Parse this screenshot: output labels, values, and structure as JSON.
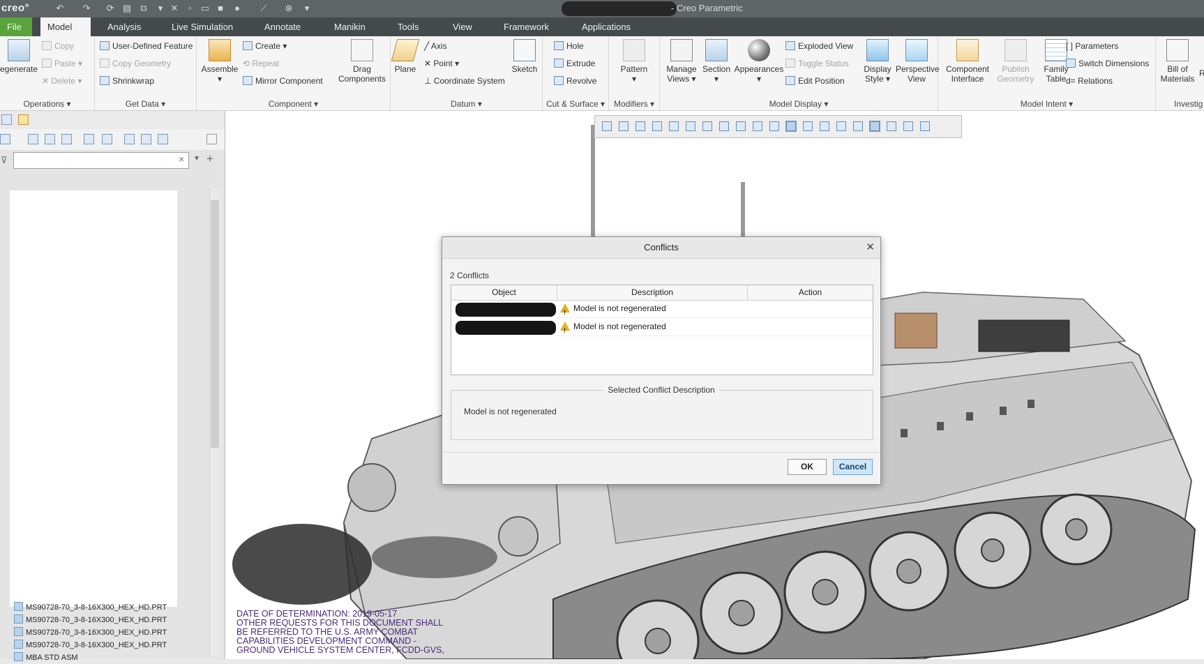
{
  "titlebar": {
    "logo": "creo°",
    "window_title": "- Creo Parametric"
  },
  "tabs": [
    "File",
    "Model",
    "Analysis",
    "Live Simulation",
    "Annotate",
    "Manikin",
    "Tools",
    "View",
    "Framework",
    "Applications"
  ],
  "ribbon": {
    "operations": {
      "regenerate": "egenerate",
      "copy": "Copy",
      "paste": "Paste",
      "delete": "Delete",
      "label": "Operations"
    },
    "get_data": {
      "udf": "User-Defined Feature",
      "copy_geometry": "Copy Geometry",
      "shrinkwrap": "Shrinkwrap",
      "label": "Get Data"
    },
    "component": {
      "assemble": "Assemble",
      "create": "Create",
      "repeat": "Repeat",
      "mirror": "Mirror Component",
      "drag_1": "Drag",
      "drag_2": "Components",
      "label": "Component"
    },
    "datum": {
      "plane": "Plane",
      "axis": "Axis",
      "point": "Point",
      "coord": "Coordinate System",
      "sketch": "Sketch",
      "label": "Datum"
    },
    "cut_surface": {
      "hole": "Hole",
      "extrude": "Extrude",
      "revolve": "Revolve",
      "label": "Cut & Surface"
    },
    "modifiers": {
      "pattern": "Pattern",
      "label": "Modifiers"
    },
    "model_display": {
      "manage_1": "Manage",
      "manage_2": "Views",
      "section": "Section",
      "appearances": "Appearances",
      "exploded": "Exploded View",
      "toggle": "Toggle Status",
      "edit_pos": "Edit Position",
      "display_1": "Display",
      "display_2": "Style",
      "persp_1": "Perspective",
      "persp_2": "View",
      "label": "Model Display"
    },
    "model_intent": {
      "comp_1": "Component",
      "comp_2": "Interface",
      "pub_1": "Publish",
      "pub_2": "Geometry",
      "fam_1": "Family",
      "fam_2": "Table",
      "parameters": "Parameters",
      "switch_dim": "Switch Dimensions",
      "relations": "Relations",
      "label": "Model Intent"
    },
    "investigate": {
      "bom_1": "Bill of",
      "bom_2": "Materials",
      "r": "R",
      "label": "Investig"
    }
  },
  "tree": {
    "rows": [
      "MS90728-70_3-8-16X300_HEX_HD.PRT",
      "MS90728-70_3-8-16X300_HEX_HD.PRT",
      "MS90728-70_3-8-16X300_HEX_HD.PRT",
      "MS90728-70_3-8-16X300_HEX_HD.PRT",
      "MBA STD ASM"
    ]
  },
  "dialog": {
    "title": "Conflicts",
    "count": "2 Conflicts",
    "columns": [
      "Object",
      "Description",
      "Action"
    ],
    "rows": [
      {
        "description": "Model is not regenerated",
        "action": ""
      },
      {
        "description": "Model is not regenerated",
        "action": ""
      }
    ],
    "selected_label": "Selected Conflict Description",
    "selected_text": "Model is not regenerated",
    "ok": "OK",
    "cancel": "Cancel"
  },
  "doc_overlay": {
    "line1": "DATE OF DETERMINATION: 2019-05-17",
    "line2": "OTHER REQUESTS FOR THIS DOCUMENT SHALL",
    "line3": "BE REFERRED TO THE U.S. ARMY COMBAT",
    "line4": "CAPABILITIES DEVELOPMENT COMMAND -",
    "line5": "GROUND VEHICLE SYSTEM CENTER, FCDD-GVS,"
  },
  "colors": {
    "file_tab": "#59a33b",
    "titlebar": "#5f6466",
    "tabbar": "#44494b",
    "cancel_btn": "#cfe6fa"
  }
}
